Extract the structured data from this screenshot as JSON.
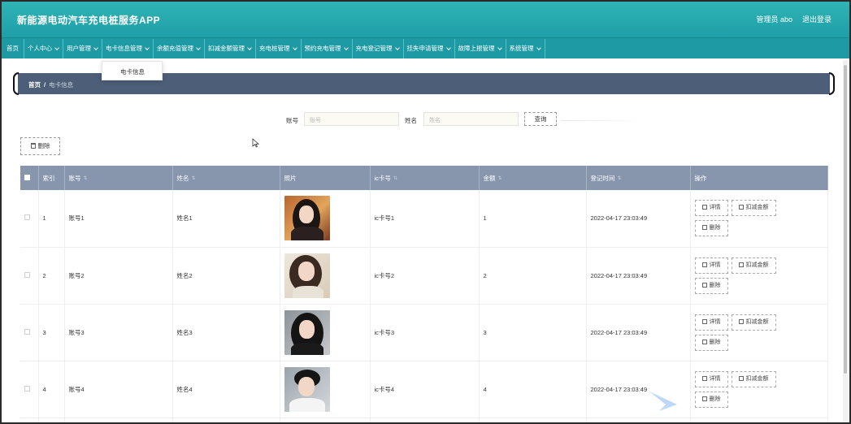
{
  "header": {
    "title": "新能源电动汽车充电桩服务APP",
    "user_label": "管理员 abo",
    "logout_label": "退出登录"
  },
  "nav": {
    "items": [
      {
        "label": "首页",
        "has_chevron": false
      },
      {
        "label": "个人中心",
        "has_chevron": true
      },
      {
        "label": "用户管理",
        "has_chevron": true
      },
      {
        "label": "电卡信息管理",
        "has_chevron": true
      },
      {
        "label": "余额充值管理",
        "has_chevron": true
      },
      {
        "label": "扣减金额管理",
        "has_chevron": true
      },
      {
        "label": "充电桩管理",
        "has_chevron": true
      },
      {
        "label": "预约充电管理",
        "has_chevron": true
      },
      {
        "label": "充电登记管理",
        "has_chevron": true
      },
      {
        "label": "挂失申请管理",
        "has_chevron": true
      },
      {
        "label": "故障上报管理",
        "has_chevron": true
      },
      {
        "label": "系统管理",
        "has_chevron": true
      }
    ],
    "dropdown_item": "电卡信息"
  },
  "breadcrumb": {
    "home": "首页",
    "separator": "/",
    "current": "电卡信息"
  },
  "search": {
    "account_label": "账号",
    "account_placeholder": "账号",
    "name_label": "姓名",
    "name_placeholder": "姓名",
    "button_label": "查询"
  },
  "toolbar": {
    "delete_label": "删除"
  },
  "table": {
    "columns": [
      "索引",
      "账号",
      "姓名",
      "照片",
      "ic卡号",
      "金额",
      "登记时间",
      "操作"
    ],
    "rows": [
      {
        "index": "1",
        "account": "账号1",
        "name": "姓名1",
        "card": "ic卡号1",
        "amount": "1",
        "time": "2022-04-17 23:03:49"
      },
      {
        "index": "2",
        "account": "账号2",
        "name": "姓名2",
        "card": "ic卡号2",
        "amount": "2",
        "time": "2022-04-17 23:03:49"
      },
      {
        "index": "3",
        "account": "账号3",
        "name": "姓名3",
        "card": "ic卡号3",
        "amount": "3",
        "time": "2022-04-17 23:03:49"
      },
      {
        "index": "4",
        "account": "账号4",
        "name": "姓名4",
        "card": "ic卡号4",
        "amount": "4",
        "time": "2022-04-17 23:03:49"
      }
    ],
    "actions": {
      "detail": "详情",
      "deduct": "扣减金额",
      "delete": "删除"
    }
  },
  "colors": {
    "header": "#2fb3b4",
    "nav": "#1d9aa3",
    "breadcrumb_bar": "#4d5f78",
    "table_header": "#8796ad"
  }
}
